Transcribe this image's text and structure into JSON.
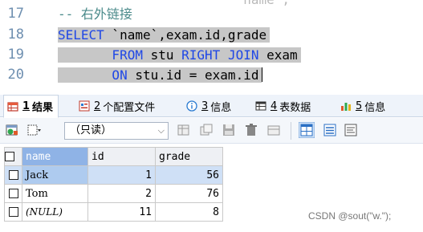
{
  "editor": {
    "top_fragment": "                       `name`,",
    "lines": [
      {
        "n": "17",
        "comment": "-- 右外链接"
      },
      {
        "n": "18",
        "parts": [
          {
            "t": "SELECT",
            "k": 1
          },
          {
            "t": " `name`,exam.id,grade",
            "k": 0
          }
        ]
      },
      {
        "n": "19",
        "parts": [
          {
            "t": "       FROM",
            "k": 1
          },
          {
            "t": " stu ",
            "k": 0
          },
          {
            "t": "RIGHT JOIN",
            "k": 1
          },
          {
            "t": " exam",
            "k": 0
          }
        ]
      },
      {
        "n": "20",
        "parts": [
          {
            "t": "       ON",
            "k": 1
          },
          {
            "t": " stu.id = exam.id",
            "k": 0
          }
        ]
      }
    ]
  },
  "tabs": [
    {
      "num": "1",
      "label": "结果",
      "icon": "result-grid-icon"
    },
    {
      "num": "2",
      "label": "个配置文件",
      "icon": "profile-icon"
    },
    {
      "num": "3",
      "label": "信息",
      "icon": "info-icon"
    },
    {
      "num": "4",
      "label": "表数据",
      "icon": "table-data-icon"
    },
    {
      "num": "5",
      "label": "信息",
      "icon": "info-chart-icon"
    }
  ],
  "toolbar": {
    "readonly_label": "（只读）"
  },
  "grid": {
    "columns": [
      "name",
      "id",
      "grade"
    ],
    "rows": [
      {
        "name": "Jack",
        "id": "1",
        "grade": "56"
      },
      {
        "name": "Tom",
        "id": "2",
        "grade": "76"
      },
      {
        "name": "(NULL)",
        "id": "11",
        "grade": "8"
      }
    ]
  },
  "watermark": "CSDN @sout(\"w.\");",
  "colors": {
    "keyword": "#1f47e6",
    "comment": "#4a8a8a",
    "selection": "#c7c7c7",
    "header_highlight": "#8fb3e6"
  }
}
